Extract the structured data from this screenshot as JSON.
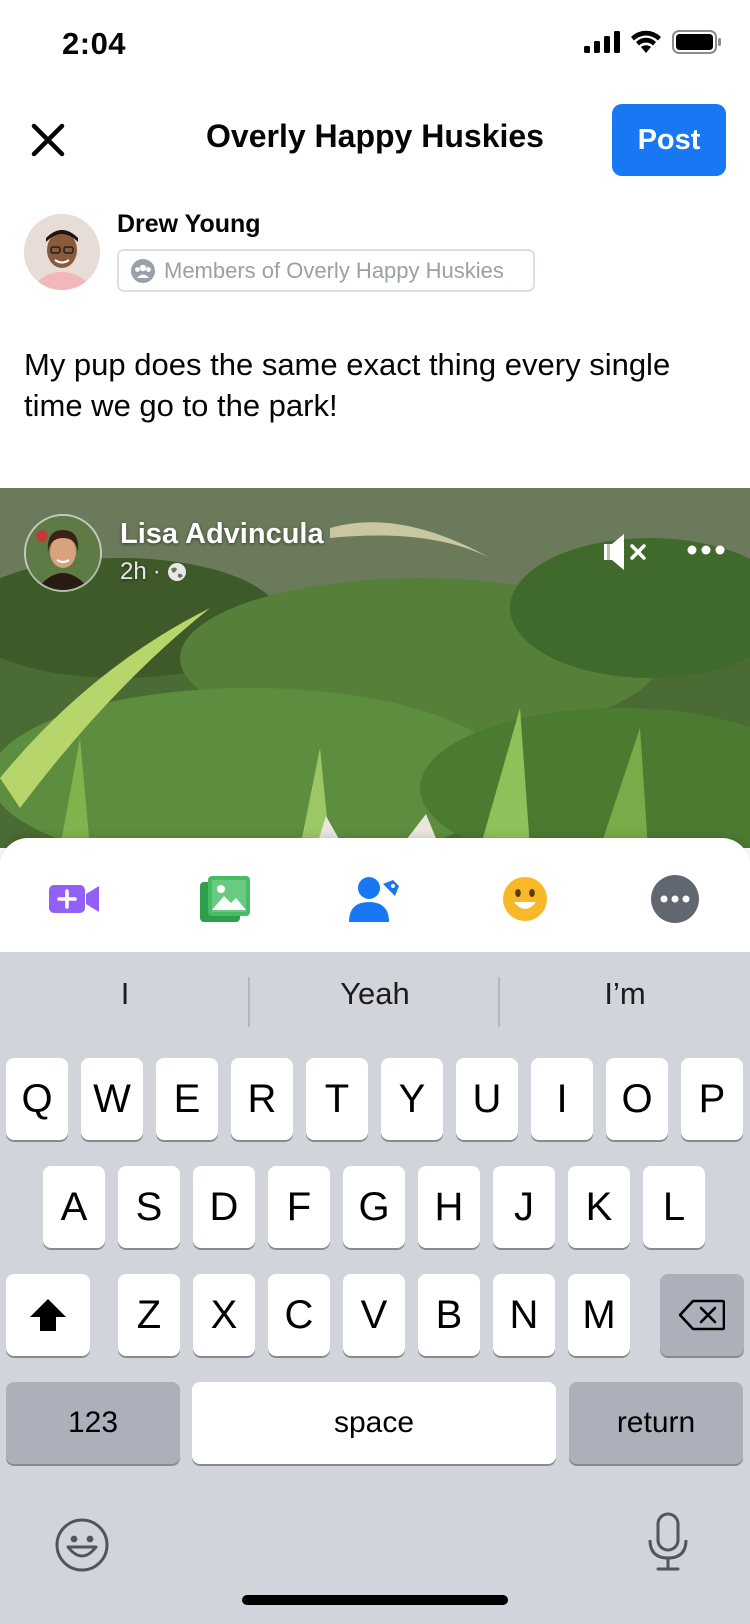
{
  "status_bar": {
    "time": "2:04"
  },
  "header": {
    "title": "Overly Happy Huskies",
    "post_label": "Post"
  },
  "author": {
    "name": "Drew Young",
    "audience": "Members of Overly Happy Huskies"
  },
  "composer": {
    "text": "My pup does the same exact thing every single time we go to the park!"
  },
  "shared_post": {
    "name": "Lisa Advincula",
    "time": "2h",
    "separator": "·"
  },
  "toolbar": {
    "items": [
      {
        "icon": "live-video-icon",
        "color": "#9360f7"
      },
      {
        "icon": "photo-icon",
        "color": "#45bd62"
      },
      {
        "icon": "tag-people-icon",
        "color": "#1877f2"
      },
      {
        "icon": "feeling-icon",
        "color": "#f7b928"
      },
      {
        "icon": "more-options-icon",
        "color": "#606770"
      }
    ]
  },
  "keyboard": {
    "suggestions": [
      "I",
      "Yeah",
      "I’m"
    ],
    "row1": [
      "Q",
      "W",
      "E",
      "R",
      "T",
      "Y",
      "U",
      "I",
      "O",
      "P"
    ],
    "row2": [
      "A",
      "S",
      "D",
      "F",
      "G",
      "H",
      "J",
      "K",
      "L"
    ],
    "row3": [
      "Z",
      "X",
      "C",
      "V",
      "B",
      "N",
      "M"
    ],
    "numbers_label": "123",
    "space_label": "space",
    "return_label": "return"
  },
  "colors": {
    "accent": "#1877f2",
    "keyboard_bg": "#d1d4da"
  }
}
